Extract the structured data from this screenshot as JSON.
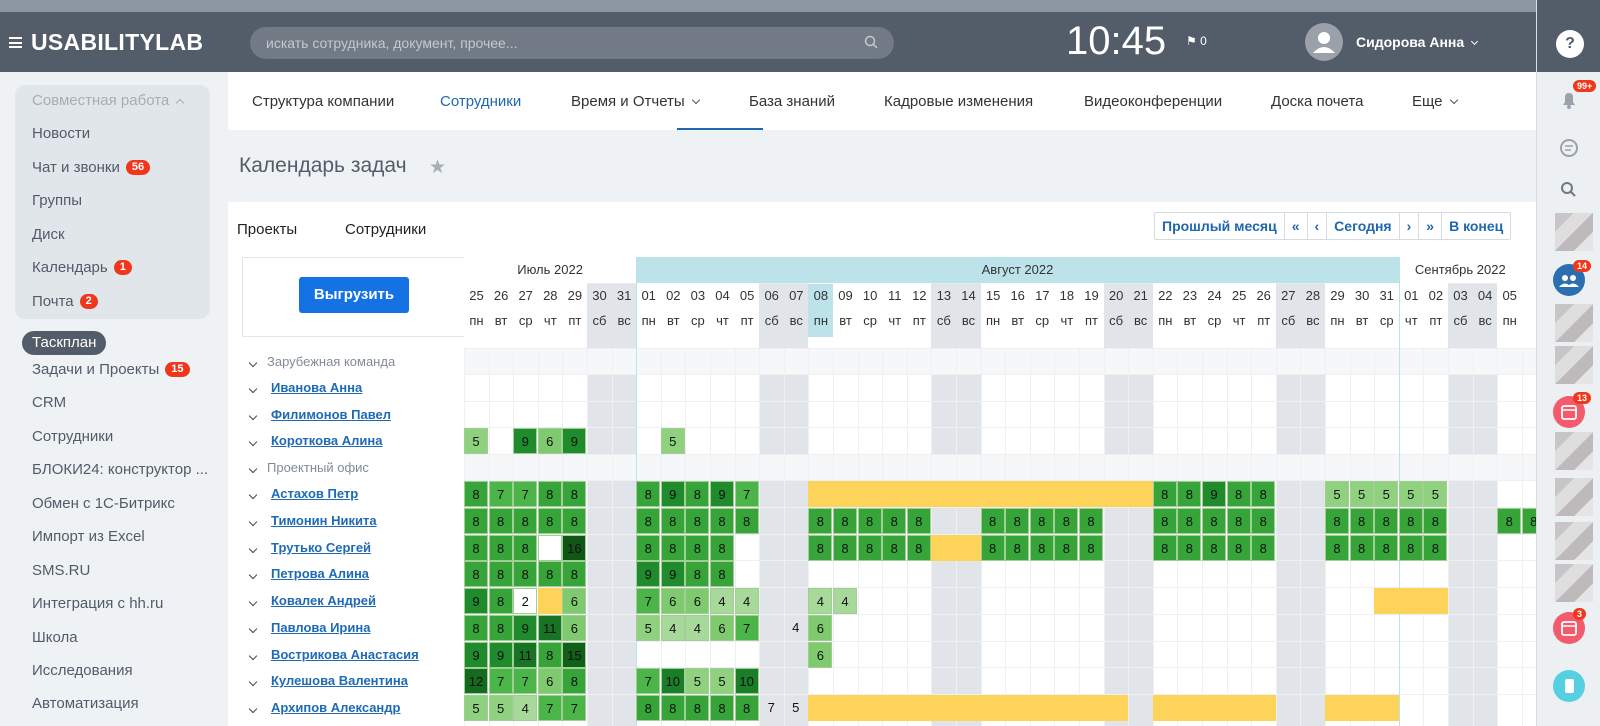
{
  "header": {
    "logo": "USABILITYLAB",
    "search_placeholder": "искать сотрудника, документ, прочее...",
    "clock": "10:45",
    "flag_count": "0",
    "user": "Сидорова Анна",
    "help": "?"
  },
  "sidebar": {
    "section": "Совместная работа",
    "items": [
      {
        "label": "Новости",
        "badge": ""
      },
      {
        "label": "Чат и звонки",
        "badge": "56"
      },
      {
        "label": "Группы",
        "badge": ""
      },
      {
        "label": "Диск",
        "badge": ""
      },
      {
        "label": "Календарь",
        "badge": "1"
      },
      {
        "label": "Почта",
        "badge": "2"
      }
    ],
    "active": "Таскплан",
    "items2": [
      {
        "label": "Задачи и Проекты",
        "badge": "15"
      },
      {
        "label": "CRM",
        "badge": ""
      },
      {
        "label": "Сотрудники",
        "badge": ""
      },
      {
        "label": "БЛОКИ24: конструктор ...",
        "badge": ""
      },
      {
        "label": "Обмен с 1С-Битрикс",
        "badge": ""
      },
      {
        "label": "Импорт из Excel",
        "badge": ""
      },
      {
        "label": "SMS.RU",
        "badge": ""
      },
      {
        "label": "Интеграция с hh.ru",
        "badge": ""
      },
      {
        "label": "Школа",
        "badge": ""
      },
      {
        "label": "Исследования",
        "badge": ""
      },
      {
        "label": "Автоматизация",
        "badge": ""
      }
    ]
  },
  "tabs": [
    {
      "label": "Структура компании",
      "dd": false
    },
    {
      "label": "Сотрудники",
      "dd": false,
      "active": true
    },
    {
      "label": "Время и Отчеты",
      "dd": true
    },
    {
      "label": "База знаний",
      "dd": false
    },
    {
      "label": "Кадровые изменения",
      "dd": false
    },
    {
      "label": "Видеоконференции",
      "dd": false
    },
    {
      "label": "Доска почета",
      "dd": false
    },
    {
      "label": "Еще",
      "dd": true
    }
  ],
  "page_title": "Календарь задач",
  "subtabs": [
    "Проекты",
    "Сотрудники"
  ],
  "nav": {
    "prev_month": "Прошлый месяц",
    "first": "«",
    "prev": "‹",
    "today": "Сегодня",
    "next": "›",
    "last": "»",
    "end": "В конец"
  },
  "export_button": "Выгрузить",
  "right_badges": {
    "notifications": "99+",
    "group": "14",
    "calendar1": "13",
    "calendar2": "3"
  },
  "calendar": {
    "months": [
      {
        "label": "Июль 2022"
      },
      {
        "label": "Август 2022"
      },
      {
        "label": "Сентябрь 2022"
      }
    ],
    "days": [
      {
        "d": "25",
        "w": "пн"
      },
      {
        "d": "26",
        "w": "вт"
      },
      {
        "d": "27",
        "w": "ср"
      },
      {
        "d": "28",
        "w": "чт"
      },
      {
        "d": "29",
        "w": "пт"
      },
      {
        "d": "30",
        "w": "сб"
      },
      {
        "d": "31",
        "w": "вс"
      },
      {
        "d": "01",
        "w": "пн"
      },
      {
        "d": "02",
        "w": "вт"
      },
      {
        "d": "03",
        "w": "ср"
      },
      {
        "d": "04",
        "w": "чт"
      },
      {
        "d": "05",
        "w": "пт"
      },
      {
        "d": "06",
        "w": "сб"
      },
      {
        "d": "07",
        "w": "вс"
      },
      {
        "d": "08",
        "w": "пн"
      },
      {
        "d": "09",
        "w": "вт"
      },
      {
        "d": "10",
        "w": "ср"
      },
      {
        "d": "11",
        "w": "чт"
      },
      {
        "d": "12",
        "w": "пт"
      },
      {
        "d": "13",
        "w": "сб"
      },
      {
        "d": "14",
        "w": "вс"
      },
      {
        "d": "15",
        "w": "пн"
      },
      {
        "d": "16",
        "w": "вт"
      },
      {
        "d": "17",
        "w": "ср"
      },
      {
        "d": "18",
        "w": "чт"
      },
      {
        "d": "19",
        "w": "пт"
      },
      {
        "d": "20",
        "w": "сб"
      },
      {
        "d": "21",
        "w": "вс"
      },
      {
        "d": "22",
        "w": "пн"
      },
      {
        "d": "23",
        "w": "вт"
      },
      {
        "d": "24",
        "w": "ср"
      },
      {
        "d": "25",
        "w": "чт"
      },
      {
        "d": "26",
        "w": "пт"
      },
      {
        "d": "27",
        "w": "сб"
      },
      {
        "d": "28",
        "w": "вс"
      },
      {
        "d": "29",
        "w": "пн"
      },
      {
        "d": "30",
        "w": "вт"
      },
      {
        "d": "31",
        "w": "ср"
      },
      {
        "d": "01",
        "w": "чт"
      },
      {
        "d": "02",
        "w": "пт"
      },
      {
        "d": "03",
        "w": "сб"
      },
      {
        "d": "04",
        "w": "вс"
      },
      {
        "d": "05",
        "w": "пн"
      }
    ],
    "rows": [
      {
        "group": "Зарубежная команда"
      },
      {
        "name": "Иванова Анна",
        "cells": []
      },
      {
        "name": "Филимонов Павел",
        "cells": []
      },
      {
        "name": "Короткова Алина",
        "cells": [
          [
            0,
            "5"
          ],
          [
            2,
            "9"
          ],
          [
            3,
            "6"
          ],
          [
            4,
            "9"
          ],
          [
            8,
            "5"
          ]
        ]
      },
      {
        "group": "Проектный офис"
      },
      {
        "name": "Астахов Петр",
        "cells": [
          [
            0,
            "8"
          ],
          [
            1,
            "7"
          ],
          [
            2,
            "7"
          ],
          [
            3,
            "8"
          ],
          [
            4,
            "8"
          ],
          [
            7,
            "8"
          ],
          [
            8,
            "9"
          ],
          [
            9,
            "8"
          ],
          [
            10,
            "9"
          ],
          [
            11,
            "7"
          ],
          [
            28,
            "8"
          ],
          [
            29,
            "8"
          ],
          [
            30,
            "9"
          ],
          [
            31,
            "8"
          ],
          [
            32,
            "8"
          ],
          [
            35,
            "5"
          ],
          [
            36,
            "5"
          ],
          [
            37,
            "5"
          ],
          [
            38,
            "5"
          ],
          [
            39,
            "5"
          ]
        ],
        "yellow": [
          [
            14,
            27
          ]
        ]
      },
      {
        "name": "Тимонин Никита",
        "cells": [
          [
            0,
            "8"
          ],
          [
            1,
            "8"
          ],
          [
            2,
            "8"
          ],
          [
            3,
            "8"
          ],
          [
            4,
            "8"
          ],
          [
            7,
            "8"
          ],
          [
            8,
            "8"
          ],
          [
            9,
            "8"
          ],
          [
            10,
            "8"
          ],
          [
            11,
            "8"
          ],
          [
            14,
            "8"
          ],
          [
            15,
            "8"
          ],
          [
            16,
            "8"
          ],
          [
            17,
            "8"
          ],
          [
            18,
            "8"
          ],
          [
            21,
            "8"
          ],
          [
            22,
            "8"
          ],
          [
            23,
            "8"
          ],
          [
            24,
            "8"
          ],
          [
            25,
            "8"
          ],
          [
            28,
            "8"
          ],
          [
            29,
            "8"
          ],
          [
            30,
            "8"
          ],
          [
            31,
            "8"
          ],
          [
            32,
            "8"
          ],
          [
            35,
            "8"
          ],
          [
            36,
            "8"
          ],
          [
            37,
            "8"
          ],
          [
            38,
            "8"
          ],
          [
            39,
            "8"
          ],
          [
            42,
            "8"
          ],
          [
            43,
            "8"
          ]
        ]
      },
      {
        "name": "Трутько Сергей",
        "cells": [
          [
            0,
            "8"
          ],
          [
            1,
            "8"
          ],
          [
            2,
            "8"
          ],
          [
            4,
            "16"
          ],
          [
            7,
            "8"
          ],
          [
            8,
            "8"
          ],
          [
            9,
            "8"
          ],
          [
            10,
            "8"
          ],
          [
            14,
            "8"
          ],
          [
            15,
            "8"
          ],
          [
            16,
            "8"
          ],
          [
            17,
            "8"
          ],
          [
            18,
            "8"
          ],
          [
            21,
            "8"
          ],
          [
            22,
            "8"
          ],
          [
            23,
            "8"
          ],
          [
            24,
            "8"
          ],
          [
            25,
            "8"
          ],
          [
            28,
            "8"
          ],
          [
            29,
            "8"
          ],
          [
            30,
            "8"
          ],
          [
            31,
            "8"
          ],
          [
            32,
            "8"
          ],
          [
            35,
            "8"
          ],
          [
            36,
            "8"
          ],
          [
            37,
            "8"
          ],
          [
            38,
            "8"
          ],
          [
            39,
            "8"
          ]
        ],
        "yellow": [
          [
            19,
            20
          ]
        ],
        "white": [
          3
        ]
      },
      {
        "name": "Петрова Алина",
        "cells": [
          [
            0,
            "8"
          ],
          [
            1,
            "8"
          ],
          [
            2,
            "8"
          ],
          [
            3,
            "8"
          ],
          [
            4,
            "8"
          ],
          [
            7,
            "9"
          ],
          [
            8,
            "9"
          ],
          [
            9,
            "8"
          ],
          [
            10,
            "8"
          ]
        ]
      },
      {
        "name": "Ковалек Андрей",
        "cells": [
          [
            0,
            "9"
          ],
          [
            1,
            "8"
          ],
          [
            4,
            "6"
          ],
          [
            7,
            "7"
          ],
          [
            8,
            "6"
          ],
          [
            9,
            "6"
          ],
          [
            10,
            "4"
          ],
          [
            11,
            "4"
          ],
          [
            14,
            "4"
          ],
          [
            15,
            "4"
          ]
        ],
        "yellow": [
          [
            3,
            3
          ],
          [
            37,
            39
          ]
        ],
        "white": [
          [
            2,
            "2"
          ]
        ]
      },
      {
        "name": "Павлова Ирина",
        "cells": [
          [
            0,
            "8"
          ],
          [
            1,
            "8"
          ],
          [
            2,
            "9"
          ],
          [
            3,
            "11"
          ],
          [
            4,
            "6"
          ],
          [
            7,
            "5"
          ],
          [
            8,
            "4"
          ],
          [
            9,
            "4"
          ],
          [
            10,
            "6"
          ],
          [
            11,
            "7"
          ],
          [
            14,
            "6"
          ]
        ],
        "plain": [
          [
            13,
            "4"
          ]
        ]
      },
      {
        "name": "Вострикова Анастасия",
        "cells": [
          [
            0,
            "9"
          ],
          [
            1,
            "9"
          ],
          [
            2,
            "11"
          ],
          [
            3,
            "8"
          ],
          [
            4,
            "15"
          ],
          [
            14,
            "6"
          ]
        ]
      },
      {
        "name": "Кулешова Валентина",
        "cells": [
          [
            0,
            "12"
          ],
          [
            1,
            "7"
          ],
          [
            2,
            "7"
          ],
          [
            3,
            "6"
          ],
          [
            4,
            "8"
          ],
          [
            7,
            "7"
          ],
          [
            8,
            "10"
          ],
          [
            9,
            "5"
          ],
          [
            10,
            "5"
          ],
          [
            11,
            "10"
          ]
        ]
      },
      {
        "name": "Архипов Александр",
        "cells": [
          [
            0,
            "5"
          ],
          [
            1,
            "5"
          ],
          [
            2,
            "4"
          ],
          [
            3,
            "7"
          ],
          [
            4,
            "7"
          ],
          [
            7,
            "8"
          ],
          [
            8,
            "8"
          ],
          [
            9,
            "8"
          ],
          [
            10,
            "8"
          ],
          [
            11,
            "8"
          ]
        ],
        "plain": [
          [
            12,
            "7"
          ],
          [
            13,
            "5"
          ]
        ],
        "yellow": [
          [
            14,
            26
          ],
          [
            28,
            32
          ],
          [
            35,
            37
          ]
        ]
      }
    ]
  },
  "colors": {
    "accent": "#2067b0",
    "header": "#535c69",
    "today": "#bde3ea",
    "weekend": "#e1e5ea",
    "yellow": "#fdd35a"
  }
}
